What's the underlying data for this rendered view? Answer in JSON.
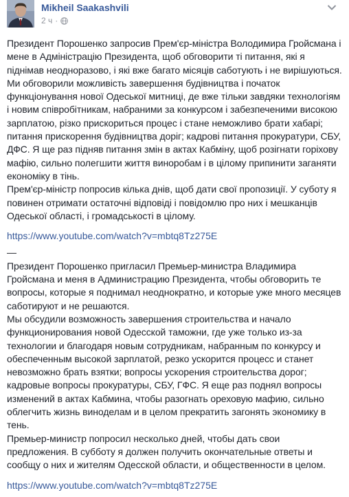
{
  "header": {
    "author_name": "Mikheil Saakashvili",
    "timestamp": "2 ч",
    "separator": "·",
    "avatar_icon": "profile-photo",
    "privacy_icon": "globe-icon",
    "menu_icon": "chevron-down-icon"
  },
  "post": {
    "ukrainian_paragraphs": [
      "Президент Порошенко запросив Прем'єр-міністра Володимира Гройсмана і мене в Адміністрацію Президента, щоб обговорити ті питання, які я піднімав неодноразово, і які вже багато місяців саботують і не вирішуються.",
      "Ми обговорили можливість завершення будівництва і початок функціонування нової Одеської митниці, де вже тільки завдяки технологіям і новим співробітникам, набраними за конкурсом і забезпеченими високою зарплатою, різко прискориться процес і стане неможливо брати хабарі; питання прискорення будівництва доріг; кадрові питання прокуратури, СБУ, ДФС. Я ще раз підняв питання змін в актах Кабміну, щоб розігнати горіхову мафію, сильно полегшити життя виноробам і в цілому припинити заганяти економіку в тінь.",
      "Прем'єр-міністр попросив кілька днів, щоб дати свої пропозиції. У суботу я повинен отримати остаточні відповіді і повідомлю про них і мешканців Одеської області, і громадськості в цілому."
    ],
    "link_1": "https://www.youtube.com/watch?v=mbtq8Tz275E",
    "divider": "—",
    "russian_paragraphs": [
      "Президент Порошенко пригласил Премьер-министра Владимира Гройсмана и меня в Администрацию Президента, чтобы обговорить те вопросы, которые я поднимал неоднократно, и которые уже много месяцев саботируют и не решаются.",
      "Мы обсудили возможность завершения строительства и начало функционирования новой Одесской таможни, где уже только из-за технологии и благодаря новым сотрудникам, набранным по конкурсу и обеспеченным высокой зарплатой, резко ускорится процесс и станет невозможно брать взятки; вопросы ускорения строительства дорог; кадровые вопросы прокуратуры, СБУ, ГФС. Я еще раз поднял вопросы изменений в актах Кабмина, чтобы разогнать ореховую мафию, сильно облегчить жизнь виноделам и в целом прекратить загонять экономику в тень.",
      "Премьер-министр попросил несколько дней, чтобы дать свои предложения. В субботу я должен получить окончательные ответы и сообщу о них и жителям Одесской области, и общественности в целом."
    ],
    "link_2": "https://www.youtube.com/watch?v=mbtq8Tz275E"
  },
  "colors": {
    "link": "#365899",
    "text": "#1d2129",
    "meta": "#90949c",
    "background": "#ffffff"
  }
}
